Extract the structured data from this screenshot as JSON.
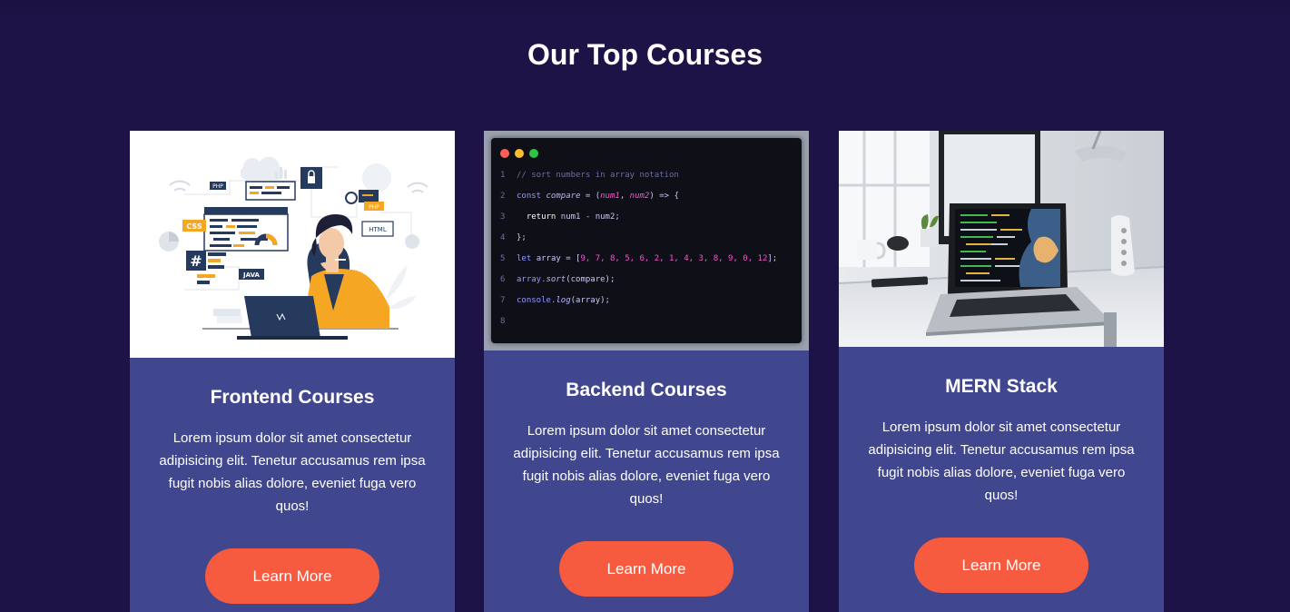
{
  "section": {
    "title": "Our Top Courses"
  },
  "courses": [
    {
      "title": "Frontend Courses",
      "description": "Lorem ipsum dolor sit amet consectetur adipisicing elit. Tenetur accusamus rem ipsa fugit nobis alias dolore, eveniet fuga vero quos!",
      "button": "Learn More",
      "image": "developer-illustration",
      "illustration_labels": {
        "css": "CSS",
        "php": "PHP",
        "html": "HTML",
        "java": "JAVA",
        "hash": "#"
      }
    },
    {
      "title": "Backend Courses",
      "description": "Lorem ipsum dolor sit amet consectetur adipisicing elit. Tenetur accusamus rem ipsa fugit nobis alias dolore, eveniet fuga vero quos!",
      "button": "Learn More",
      "image": "code-window",
      "code": {
        "l1": "// sort numbers in array notation",
        "l2a": "const ",
        "l2b": "compare",
        "l2c": " = (",
        "l2d": "num1",
        "l2e": ", ",
        "l2f": "num2",
        "l2g": ") => {",
        "l3a": "  return ",
        "l3b": "num1 - num2;",
        "l4": "};",
        "l5a": "let ",
        "l5b": "array = [",
        "l5c": "9, 7, 8, 5, 6, 2, 1, 4, 3, 8, 9, 0, 12",
        "l5d": "];",
        "l6a": "array.",
        "l6b": "sort",
        "l6c": "(compare);",
        "l7a": "console.",
        "l7b": "log",
        "l7c": "(array);",
        "n1": "1",
        "n2": "2",
        "n3": "3",
        "n4": "4",
        "n5": "5",
        "n6": "6",
        "n7": "7",
        "n8": "8"
      }
    },
    {
      "title": "MERN Stack",
      "description": "Lorem ipsum dolor sit amet consectetur adipisicing elit. Tenetur accusamus rem ipsa fugit nobis alias dolore, eveniet fuga vero quos!",
      "button": "Learn More",
      "image": "laptop-desk-photo"
    }
  ],
  "colors": {
    "background": "#1e1346",
    "card": "#41478e",
    "button": "#f65a3f",
    "accent_orange": "#f5a623",
    "navy": "#263a5e"
  }
}
